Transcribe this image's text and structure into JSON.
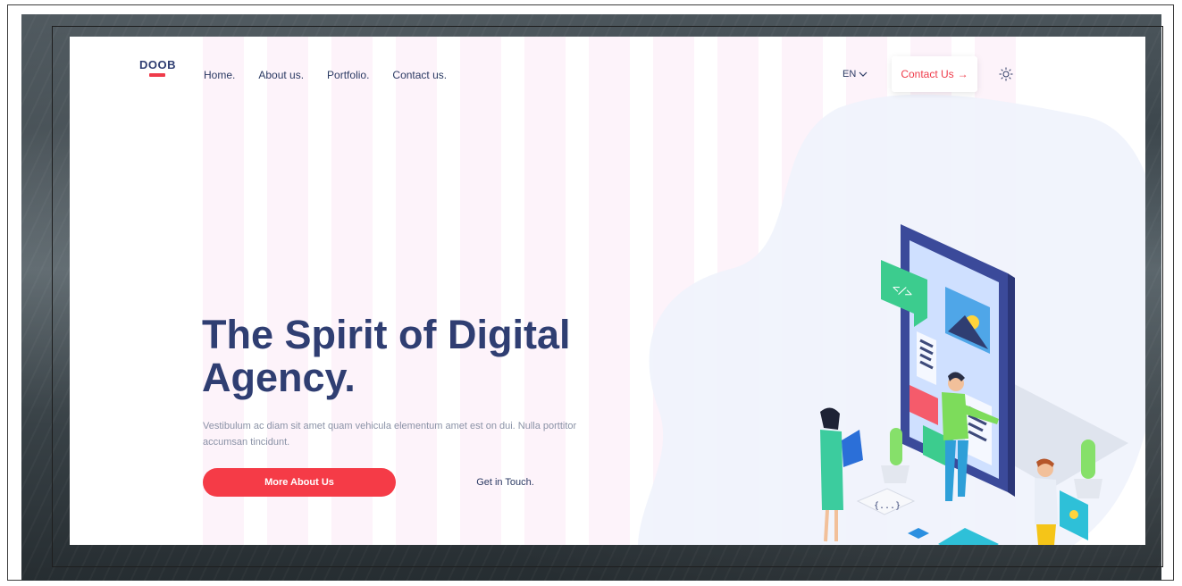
{
  "header": {
    "logo_text": "DOOB",
    "nav": [
      "Home.",
      "About us.",
      "Portfolio.",
      "Contact us."
    ],
    "language": "EN",
    "contact_button": "Contact Us",
    "contact_arrow": "→"
  },
  "hero": {
    "title": "The Spirit of Digital Agency.",
    "subtitle": "Vestibulum ac diam sit amet quam vehicula elementum amet est on dui. Nulla porttitor accumsan tincidunt.",
    "primary_cta": "More About Us",
    "secondary_cta": "Get in Touch."
  },
  "illustration": {
    "code_tag": "</>",
    "brace_tag": "{...}"
  },
  "colors": {
    "brand": "#2f3e72",
    "accent": "#f53b47",
    "stripe": "#fdf3fa",
    "phone": "#3b4a9a",
    "green": "#3ccc8e"
  }
}
